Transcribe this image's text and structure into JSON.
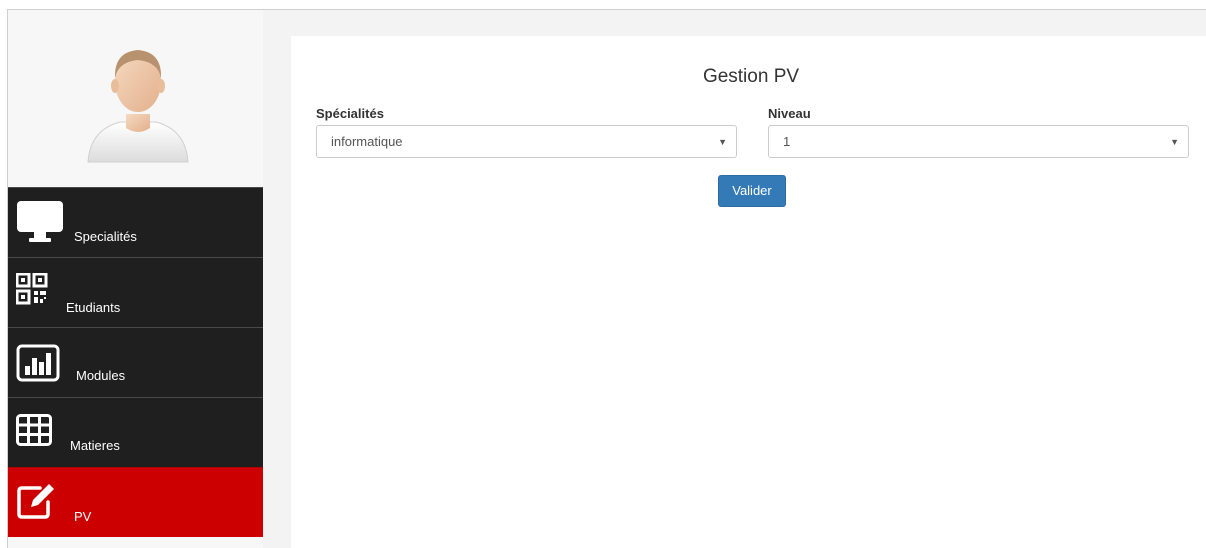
{
  "sidebar": {
    "items": [
      {
        "label": "Specialités",
        "icon": "monitor-icon"
      },
      {
        "label": "Etudiants",
        "icon": "qr-code-icon"
      },
      {
        "label": "Modules",
        "icon": "bar-chart-icon"
      },
      {
        "label": "Matieres",
        "icon": "table-grid-icon"
      },
      {
        "label": "PV",
        "icon": "edit-icon",
        "active": true
      }
    ]
  },
  "main": {
    "title": "Gestion PV",
    "specialites": {
      "label": "Spécialités",
      "value": "informatique"
    },
    "niveau": {
      "label": "Niveau",
      "value": "1"
    },
    "submit_label": "Valider"
  },
  "colors": {
    "sidebar_bg": "#1f1f1f",
    "active_bg": "#cc0000",
    "button": "#337ab7"
  }
}
